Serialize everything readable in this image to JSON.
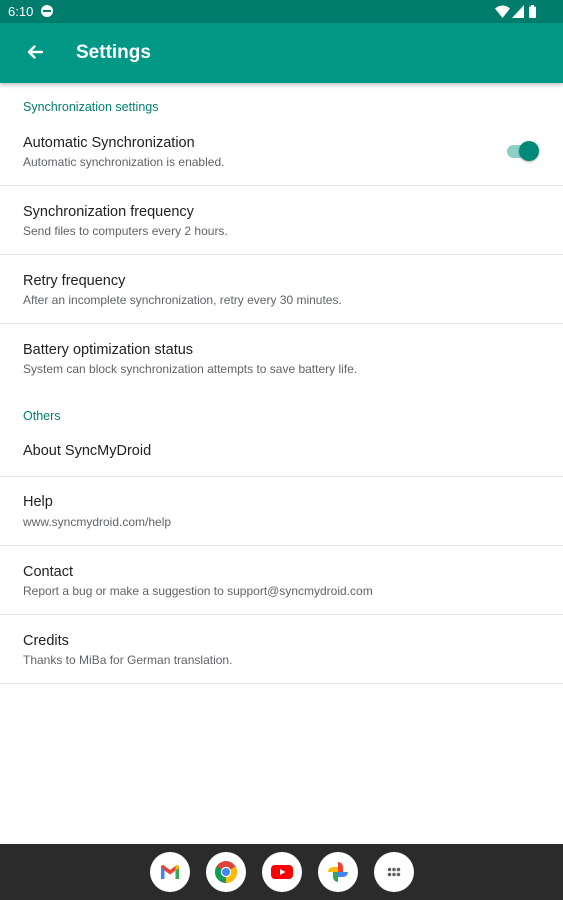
{
  "status_bar": {
    "time": "6:10",
    "icons": [
      "dnd-icon",
      "wifi-icon",
      "signal-icon",
      "battery-icon"
    ]
  },
  "app_bar": {
    "title": "Settings",
    "back_icon": "arrow-back-icon",
    "color": "#019886"
  },
  "sections": [
    {
      "header": "Synchronization settings",
      "items": [
        {
          "title": "Automatic Synchronization",
          "summary": "Automatic synchronization is enabled.",
          "toggle_on": true
        },
        {
          "title": "Synchronization frequency",
          "summary": "Send files to computers every 2 hours."
        },
        {
          "title": "Retry frequency",
          "summary": "After an incomplete synchronization, retry every 30 minutes."
        },
        {
          "title": "Battery optimization status",
          "summary": "System can block synchronization attempts to save battery life."
        }
      ]
    },
    {
      "header": "Others",
      "items": [
        {
          "title": "About SyncMyDroid"
        },
        {
          "title": "Help",
          "summary": "www.syncmydroid.com/help"
        },
        {
          "title": "Contact",
          "summary": "Report a bug or make a suggestion to support@syncmydroid.com"
        },
        {
          "title": "Credits",
          "summary": "Thanks to MiBa for German translation."
        }
      ]
    }
  ],
  "dock": [
    "gmail-icon",
    "chrome-icon",
    "youtube-icon",
    "photos-icon",
    "app-drawer-icon"
  ],
  "colors": {
    "accent": "#017f6f",
    "toggle_thumb": "#018a78",
    "toggle_track": "#8ccfc6"
  }
}
